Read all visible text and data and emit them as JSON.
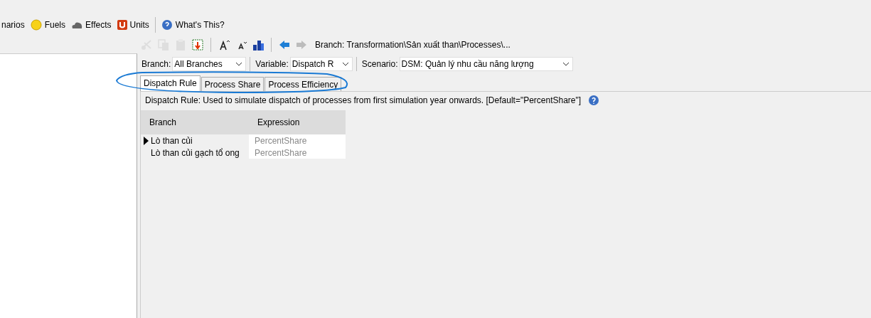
{
  "menu": [
    {
      "label": "narios",
      "kind": "plain"
    },
    {
      "label": "Fuels",
      "kind": "sun"
    },
    {
      "label": "Effects",
      "kind": "cloud"
    },
    {
      "label": "Units",
      "kind": "u"
    },
    {
      "label": "What's This?",
      "kind": "help"
    }
  ],
  "toolbar": {
    "tools": [
      {
        "kind": "cut",
        "disabled": true
      },
      {
        "kind": "copy",
        "disabled": true
      },
      {
        "kind": "paste",
        "disabled": true
      },
      {
        "kind": "export",
        "disabled": false
      },
      {
        "kind": "grow",
        "disabled": false
      },
      {
        "kind": "shrink",
        "disabled": false
      },
      {
        "kind": "chart",
        "disabled": false
      },
      {
        "kind": "back",
        "disabled": false
      },
      {
        "kind": "forward",
        "disabled": true
      }
    ],
    "path": "Branch: Transformation\\Sản xuất than\\Processes\\..."
  },
  "filters": [
    {
      "label": "Branch:",
      "value": "All Branches"
    },
    {
      "label": "Variable:",
      "value": "Dispatch R"
    },
    {
      "label": "Scenario:",
      "value": "DSM: Quản lý nhu cầu năng lượng"
    }
  ],
  "tabs": [
    {
      "label": "Dispatch Rule",
      "selected": true
    },
    {
      "label": "Process Share",
      "selected": false
    },
    {
      "label": "Process Efficiency",
      "selected": false
    }
  ],
  "description": "Dispatch Rule: Used to simulate dispatch of processes from first simulation year onwards. [Default=\"PercentShare\"]",
  "table": {
    "columns": [
      "Branch",
      "Expression"
    ],
    "rows": [
      {
        "branch": "Lò than củi",
        "expression": "PercentShare",
        "current": true
      },
      {
        "branch": "Lò than củi gạch tổ ong",
        "expression": "PercentShare",
        "current": false
      }
    ]
  }
}
